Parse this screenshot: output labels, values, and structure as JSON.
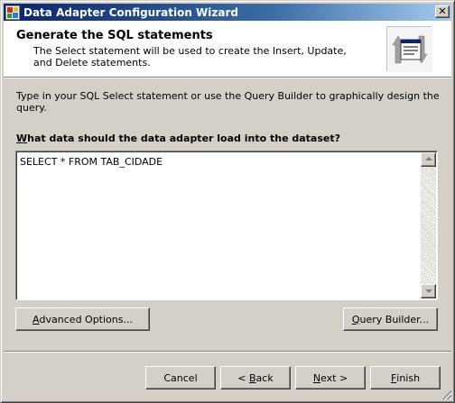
{
  "window": {
    "title": "Data Adapter Configuration Wizard"
  },
  "header": {
    "title": "Generate the SQL statements",
    "description": "The Select statement will be used to create the Insert, Update, and Delete statements."
  },
  "content": {
    "intro": "Type in your SQL Select statement or use the Query Builder to graphically design the query.",
    "question_accel": "W",
    "question_rest": "hat data should the data adapter load into the dataset?",
    "sql_text": "SELECT * FROM TAB_CIDADE"
  },
  "buttons": {
    "advanced_accel": "A",
    "advanced_rest": "dvanced Options...",
    "query_accel": "Q",
    "query_rest": "uery Builder...",
    "cancel": "Cancel",
    "back_prefix": "< ",
    "back_accel": "B",
    "back_rest": "ack",
    "next_accel": "N",
    "next_rest": "ext >",
    "finish_accel": "F",
    "finish_rest": "inish"
  },
  "icons": {
    "app": "wizard-app-icon",
    "close": "close-icon",
    "header": "sql-document-arrows-icon"
  },
  "colors": {
    "titlebar_start": "#0a246a",
    "titlebar_end": "#a6caf0",
    "face": "#d4d0c8"
  }
}
